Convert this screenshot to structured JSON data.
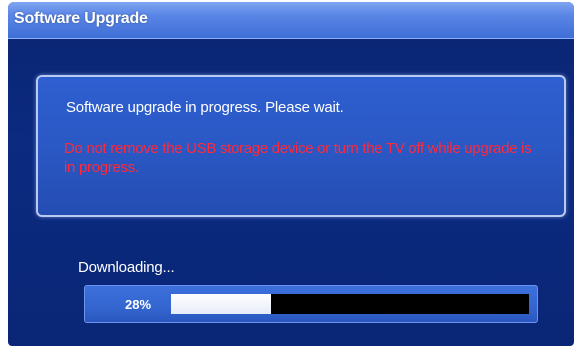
{
  "window": {
    "title": "Software Upgrade"
  },
  "dialog": {
    "message": "Software upgrade in progress. Please wait.",
    "warning": "Do not remove the USB storage device or turn the TV off while upgrade is in progress."
  },
  "progress": {
    "label": "Downloading...",
    "percent_text": "28%",
    "value": 0.28
  },
  "colors": {
    "warning_text": "#ff2a3a",
    "background": "#0a2676",
    "title_bar": "#4f7ee2",
    "progress_fill": "#ffffff",
    "progress_track": "#000000"
  }
}
